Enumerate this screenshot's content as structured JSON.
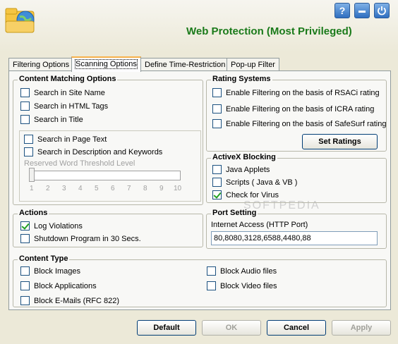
{
  "header": {
    "title": "Web Protection (Most Privileged)",
    "help_icon": "?",
    "minimize_icon": "minimize-icon",
    "power_icon": "power-icon"
  },
  "tabs": [
    {
      "label": "Filtering Options"
    },
    {
      "label": "Scanning Options"
    },
    {
      "label": "Define Time-Restriction"
    },
    {
      "label": "Pop-up Filter"
    }
  ],
  "content_matching": {
    "title": "Content Matching Options",
    "site_name": "Search in Site Name",
    "html_tags": "Search in HTML Tags",
    "title_opt": "Search in Title",
    "page_text": "Search in Page Text",
    "description": "Search in Description and Keywords",
    "threshold_label": "Reserved Word Threshold Level",
    "threshold_value": 1,
    "ticks": [
      "1",
      "2",
      "3",
      "4",
      "5",
      "6",
      "7",
      "8",
      "9",
      "10"
    ]
  },
  "rating": {
    "title": "Rating Systems",
    "rsaci": "Enable Filtering on the basis of RSACi rating",
    "icra": "Enable Filtering on the basis of ICRA rating",
    "safesurf": "Enable Filtering on the basis of SafeSurf rating",
    "set_ratings": "Set Ratings"
  },
  "activex": {
    "title": "ActiveX Blocking",
    "java_applets": "Java Applets",
    "scripts": "Scripts ( Java & VB )",
    "check_virus": "Check for Virus"
  },
  "actions": {
    "title": "Actions",
    "log_violations": "Log Violations",
    "shutdown": "Shutdown Program in 30 Secs."
  },
  "port": {
    "title": "Port Setting",
    "label": "Internet Access (HTTP Port)",
    "value": "80,8080,3128,6588,4480,88"
  },
  "content_type": {
    "title": "Content Type",
    "images": "Block Images",
    "applications": "Block Applications",
    "emails": "Block E-Mails (RFC 822)",
    "audio": "Block Audio files",
    "video": "Block Video files"
  },
  "buttons": {
    "default": "Default",
    "ok": "OK",
    "cancel": "Cancel",
    "apply": "Apply"
  },
  "watermark": "SOFTPEDIA",
  "colors": {
    "title": "#1a7a1a",
    "tab_highlight": "#f7b14a",
    "check": "#21a121"
  }
}
